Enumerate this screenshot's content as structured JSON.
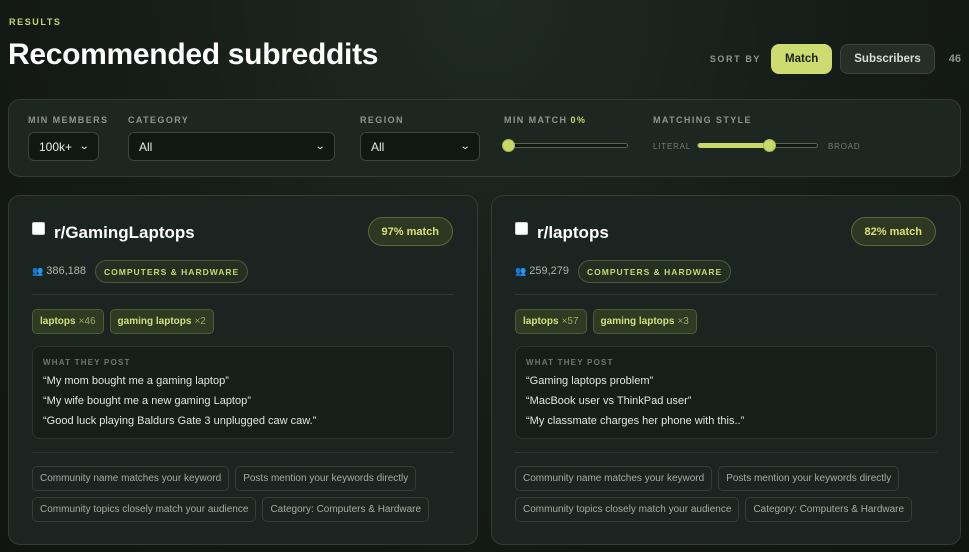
{
  "header": {
    "eyebrow": "RESULTS",
    "title": "Recommended subreddits",
    "sort_label": "SORT BY",
    "sort_options": [
      "Match",
      "Subscribers"
    ],
    "sort_active": "Match",
    "count": "46"
  },
  "filters": {
    "min_members": {
      "label": "MIN MEMBERS",
      "value": "100k+"
    },
    "category": {
      "label": "CATEGORY",
      "value": "All"
    },
    "region": {
      "label": "REGION",
      "value": "All"
    },
    "min_match": {
      "label": "MIN MATCH",
      "value_text": "0%",
      "value": 0
    },
    "matching_style": {
      "label": "MATCHING STYLE",
      "left": "LITERAL",
      "right": "BROAD",
      "value": 0.6
    }
  },
  "cards": [
    {
      "name": "r/GamingLaptops",
      "match": "97% match",
      "members": "386,188",
      "category": "COMPUTERS & HARDWARE",
      "keywords": [
        {
          "term": "laptops",
          "count": "×46"
        },
        {
          "term": "gaming laptops",
          "count": "×2"
        }
      ],
      "posts_label": "WHAT THEY POST",
      "posts": [
        "“My mom bought me a gaming laptop”",
        "“My wife bought me a new gaming Laptop”",
        "“Good luck playing Baldurs Gate 3 unplugged caw caw.”"
      ],
      "reasons": [
        "Community name matches your keyword",
        "Posts mention your keywords directly",
        "Community topics closely match your audience",
        "Category: Computers & Hardware"
      ]
    },
    {
      "name": "r/laptops",
      "match": "82% match",
      "members": "259,279",
      "category": "COMPUTERS & HARDWARE",
      "keywords": [
        {
          "term": "laptops",
          "count": "×57"
        },
        {
          "term": "gaming laptops",
          "count": "×3"
        }
      ],
      "posts_label": "WHAT THEY POST",
      "posts": [
        "“Gaming laptops problem”",
        "“MacBook user vs ThinkPad user”",
        "“My classmate charges her phone with this..”"
      ],
      "reasons": [
        "Community name matches your keyword",
        "Posts mention your keywords directly",
        "Community topics closely match your audience",
        "Category: Computers & Hardware"
      ]
    }
  ],
  "icons": {
    "members": "people-icon",
    "select": "chevron-down-icon"
  },
  "colors": {
    "accent": "#cddc70",
    "background": "#141a16",
    "card": "#1b2420"
  }
}
